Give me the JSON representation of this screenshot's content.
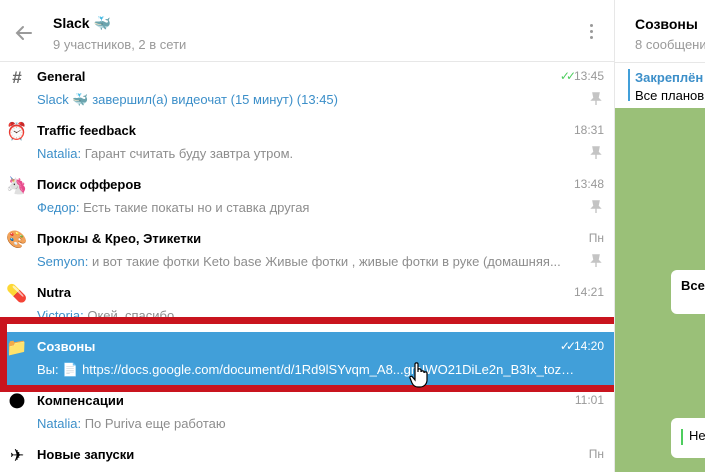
{
  "header": {
    "title": "Slack 🐳",
    "subtitle": "9 участников, 2 в сети"
  },
  "chats": [
    {
      "icon": "hash-icon",
      "name": "General",
      "time": "13:45",
      "sender": "Slack 🐳",
      "text": "завершил(а) видеочат (15 минут) (13:45)",
      "pinned": true,
      "read": true,
      "active": false
    },
    {
      "icon": "alarm-clock-icon",
      "name": "Traffic feedback",
      "time": "18:31",
      "sender": "Natalia:",
      "text": "Гарант считать буду завтра утром.",
      "pinned": true,
      "read": false,
      "active": false
    },
    {
      "icon": "unicorn-icon",
      "name": "Поиск офферов",
      "time": "13:48",
      "sender": "Федор:",
      "text": "Есть такие покаты но и ставка другая",
      "pinned": true,
      "read": false,
      "active": false
    },
    {
      "icon": "palette-icon",
      "name": "Проклы & Крео, Этикетки",
      "time": "Пн",
      "sender": "Semyon:",
      "text": "и вот такие фотки Keto base  Живые фотки , живые фотки в руке (домашняя...",
      "pinned": true,
      "read": false,
      "active": false
    },
    {
      "icon": "pill-icon",
      "name": "Nutra",
      "time": "14:21",
      "sender": "Victoria:",
      "text": "Окей, спасибо",
      "pinned": false,
      "read": false,
      "active": false
    },
    {
      "icon": "folder-icon",
      "name": "Созвоны",
      "time": "14:20",
      "sender": "Вы:",
      "text": "📄 https://docs.google.com/document/d/1Rd9lSYvqm_A8...gmIWO21DiLe2n_B3Ix_tozZ...",
      "pinned": false,
      "read": true,
      "active": true
    },
    {
      "icon": "globe-icon",
      "name": "Компенсации",
      "time": "11:01",
      "sender": "Natalia:",
      "text": "По Puriva еще работаю",
      "pinned": false,
      "read": false,
      "active": false
    },
    {
      "icon": "airplane-icon",
      "name": "Новые запуски",
      "time": "Пн",
      "sender": "",
      "text": "",
      "pinned": false,
      "read": false,
      "active": false
    }
  ],
  "right_panel": {
    "title": "Созвоны",
    "subtitle": "8 сообщени",
    "pinned_label": "Закреплён",
    "pinned_text": "Все планов",
    "bubble1": "Все",
    "bubble2": "Не"
  }
}
